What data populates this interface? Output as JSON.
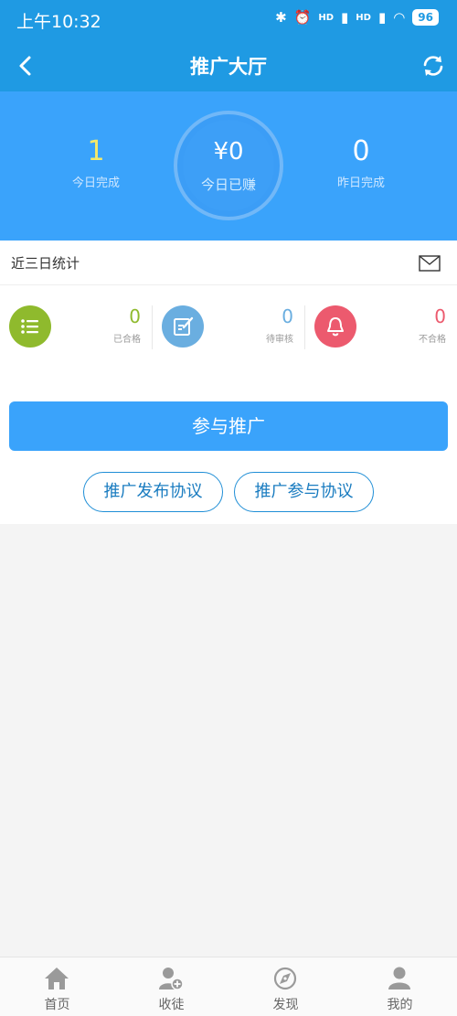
{
  "status_bar": {
    "time": "上午10:32",
    "battery": "96",
    "signal1": "HD",
    "signal2": "HD"
  },
  "header": {
    "title": "推广大厅",
    "back_icon": "back-arrow-icon",
    "refresh_icon": "refresh-icon"
  },
  "banner": {
    "left": {
      "value": "1",
      "label": "今日完成"
    },
    "center": {
      "value": "¥0",
      "label": "今日已赚"
    },
    "right": {
      "value": "0",
      "label": "昨日完成"
    }
  },
  "recent": {
    "title": "近三日统计",
    "icon": "mail-icon"
  },
  "cards": [
    {
      "value": "0",
      "label": "已合格",
      "color": "#8fba2d",
      "icon": "list-icon"
    },
    {
      "value": "0",
      "label": "待审核",
      "color": "#6aaee0",
      "icon": "edit-icon"
    },
    {
      "value": "0",
      "label": "不合格",
      "color": "#ec5a6e",
      "icon": "bell-icon"
    }
  ],
  "actions": {
    "join": "参与推广",
    "publish_agreement": "推广发布协议",
    "participate_agreement": "推广参与协议"
  },
  "bottom_nav": [
    {
      "label": "首页",
      "icon": "home-icon"
    },
    {
      "label": "收徒",
      "icon": "add-user-icon"
    },
    {
      "label": "发现",
      "icon": "discover-icon"
    },
    {
      "label": "我的",
      "icon": "profile-icon"
    }
  ],
  "colors": {
    "header": "#1f9ae3",
    "banner": "#3aa3fb",
    "accent_yellow": "#f4e96a"
  }
}
